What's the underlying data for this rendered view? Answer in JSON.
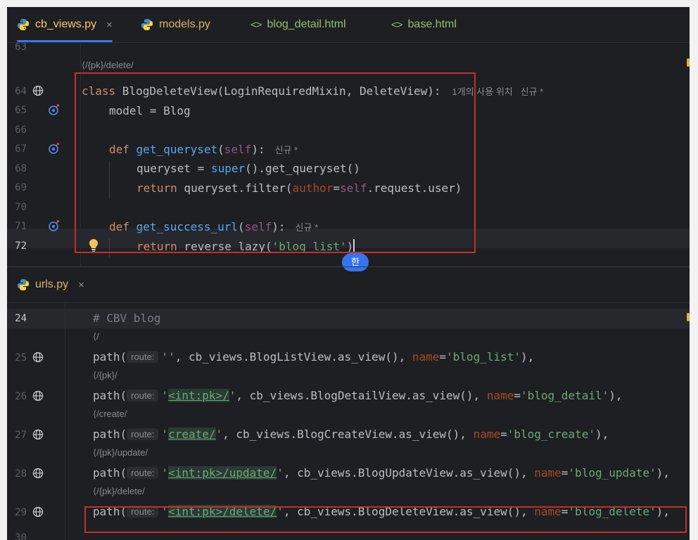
{
  "tabs": [
    {
      "label": "cb_views.py",
      "type": "py",
      "active": true,
      "close": "×"
    },
    {
      "label": "models.py",
      "type": "py",
      "active": false
    },
    {
      "label": "blog_detail.html",
      "type": "html",
      "active": false
    },
    {
      "label": "base.html",
      "type": "html",
      "active": false
    }
  ],
  "html_icon_glyph": "<>",
  "top_pane": {
    "lines": {
      "l63": "63",
      "l64": "64",
      "l65": "65",
      "l66": "66",
      "l67": "67",
      "l68": "68",
      "l69": "69",
      "l70": "70",
      "l71": "71",
      "l72": "72"
    },
    "usage_hint": "/{pk}/delete/",
    "class_hint": "1개의 사용 위치   신규 *",
    "new_hint": "신규 *",
    "code": {
      "c64a": "class",
      "c64b": " BlogDeleteView(LoginRequiredMixin, DeleteView):",
      "c65": "model = Blog",
      "c67a": "def",
      "c67b": "get_queryset",
      "c67c": "(",
      "c67d": "self",
      "c67e": "):",
      "c68a": "queryset = ",
      "c68b": "super",
      "c68c": "().get_queryset()",
      "c69a": "return",
      "c69b": " queryset.filter(",
      "c69c": "author",
      "c69d": "=",
      "c69e": "self",
      "c69f": ".request.user)",
      "c71a": "def",
      "c71b": "get_success_url",
      "c71c": "(",
      "c71d": "self",
      "c71e": "):",
      "c72a": "return",
      "c72b": " reverse_lazy(",
      "c72c": "'blog_list'",
      "c72d": ")"
    }
  },
  "ime_indicator": "한",
  "bottom_tab": {
    "label": "urls.py",
    "close": "×"
  },
  "bottom_pane": {
    "lines": {
      "l24": "24",
      "l25": "25",
      "l26": "26",
      "l27": "27",
      "l28": "28",
      "l29": "29",
      "l30": "30"
    },
    "comment": "# CBV blog",
    "route_badge": "route:",
    "usages": [
      "/",
      "/{pk}/",
      "/create/",
      "/{pk}/update/",
      "/{pk}/delete/"
    ],
    "rows": [
      {
        "pre": "'",
        "route": "",
        "post": "'",
        "rest": ", cb_views.BlogListView.as_view(), ",
        "name_kw": "name",
        "eq": "=",
        "name_val": "'blog_list'",
        "end": "),"
      },
      {
        "pre": "'",
        "route": "<int:pk>/",
        "post": "'",
        "rest": ", cb_views.BlogDetailView.as_view(), ",
        "name_kw": "name",
        "eq": "=",
        "name_val": "'blog_detail'",
        "end": "),"
      },
      {
        "pre": "'",
        "route": "create/",
        "post": "'",
        "rest": ", cb_views.BlogCreateView.as_view(), ",
        "name_kw": "name",
        "eq": "=",
        "name_val": "'blog_create'",
        "end": "),"
      },
      {
        "pre": "'",
        "route": "<int:pk>/update/",
        "post": "'",
        "rest": ", cb_views.BlogUpdateView.as_view(), ",
        "name_kw": "name",
        "eq": "=",
        "name_val": "'blog_update'",
        "end": "),"
      },
      {
        "pre": "'",
        "route": "<int:pk>/delete/",
        "post": "'",
        "rest": ", cb_views.BlogDeleteView.as_view(), ",
        "name_kw": "name",
        "eq": "=",
        "name_val": "'blog_delete'",
        "end": "),"
      }
    ],
    "path_fn": "path("
  },
  "colors": {
    "accent": "#3574f0",
    "highlight_box": "#c2302c",
    "background": "#1e1f22"
  }
}
